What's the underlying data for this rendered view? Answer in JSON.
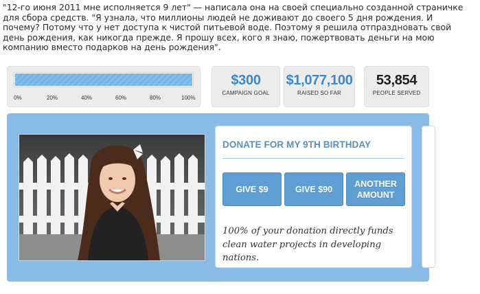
{
  "article": {
    "quote": "\"12-го июня 2011 мне исполняется 9 лет\" — написала она на своей специально созданной страничке\nдля сбора средств. \"Я узнала, что миллионы людей не доживают до своего 5 дня рождения. И\nпочему? Потому что у нет доступа к чистой питьевой воде. Поэтому я решила отпраздновать свой\nдень рождения, как никогда прежде. Я прошу всех, кого я знаю, пожертвовать деньги на мою\nкомпанию вместо подарков на день рождения\"."
  },
  "progress": {
    "fraction": 1.0,
    "ticks": [
      "0%",
      "20%",
      "40%",
      "60%",
      "80%",
      "100%"
    ]
  },
  "stats": [
    {
      "value": "$300",
      "label": "CAMPAIGN GOAL",
      "color": "#3f88c7"
    },
    {
      "value": "$1,077,100",
      "label": "RAISED SO FAR",
      "color": "#3f88c7"
    },
    {
      "value": "53,854",
      "label": "PEOPLE SERVED",
      "color": "#1e1e1e"
    }
  ],
  "donate": {
    "title": "DONATE FOR MY 9TH BIRTHDAY",
    "buttons": [
      "GIVE $9",
      "GIVE $90",
      "ANOTHER\nAMOUNT"
    ],
    "note": "100% of your donation directly funds clean water projects in developing nations."
  },
  "colors": {
    "accent": "#5f9fd3",
    "panel_bg": "#88bce6",
    "title_blue": "#5a8fb8"
  }
}
